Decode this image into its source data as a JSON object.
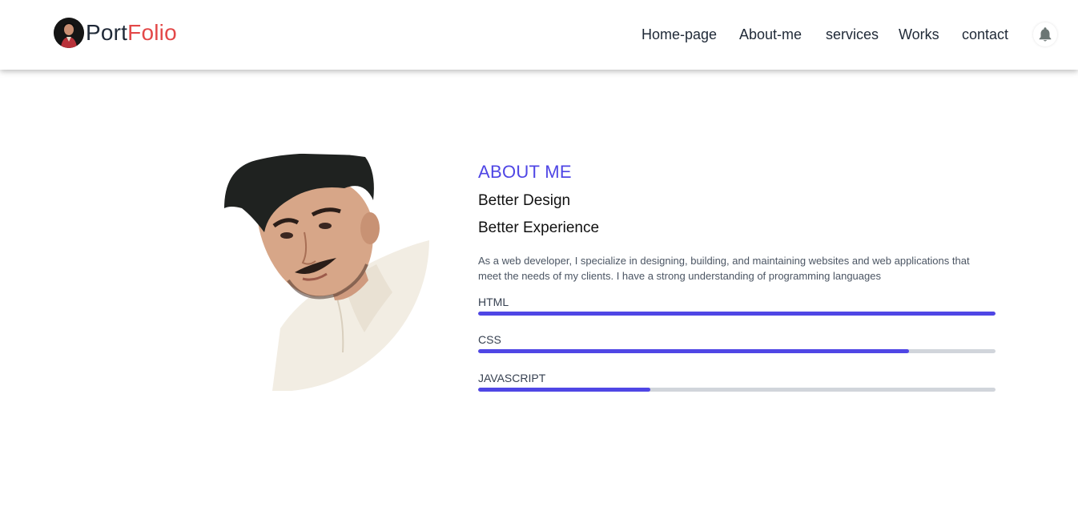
{
  "brand": {
    "first": "Port",
    "second": "Folio",
    "first_color": "#1f2937",
    "second_color": "#e34848"
  },
  "nav": {
    "links": [
      "Home-page",
      "About-me",
      "services",
      "Works",
      "contact"
    ],
    "bell_icon": "bell-icon"
  },
  "about": {
    "heading": "ABOUT ME",
    "line1": "Better Design",
    "line2": "Better Experience",
    "description": "As a web developer, I specialize in designing, building, and maintaining websites and web applications that meet the needs of my clients. I have a strong understanding of programming languages",
    "accent_color": "#4f46e5"
  },
  "skills": [
    {
      "name": "HTML",
      "level": 1.0
    },
    {
      "name": "CSS",
      "level": 0.833
    },
    {
      "name": "JAVASCRIPT",
      "level": 0.333
    }
  ]
}
